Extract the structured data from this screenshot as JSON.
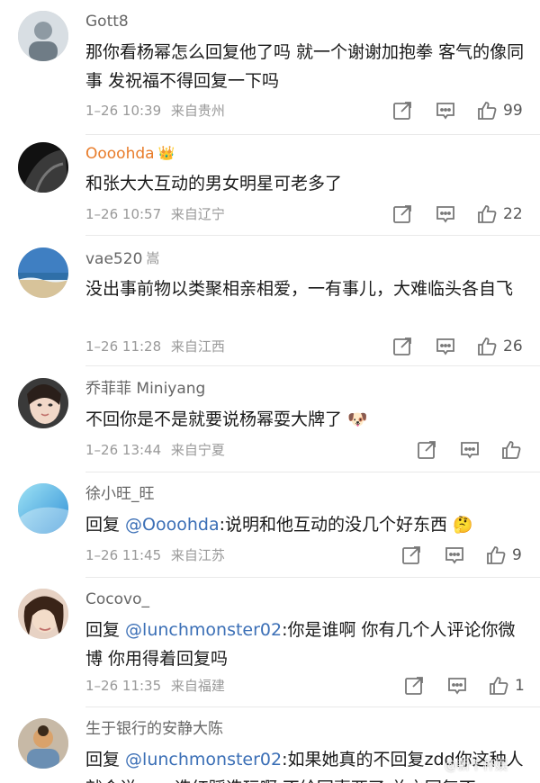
{
  "comments": [
    {
      "username": "Gott8",
      "text": "那你看杨幂怎么回复他了吗 就一个谢谢加抱拳 客气的像同事 发祝福不得回复一下吗",
      "time": "1–26 10:39",
      "location": "来自贵州",
      "likes": "99",
      "avatar_color": "#8e9aa3"
    },
    {
      "username": "Oooohda",
      "badge": "👑",
      "text": "和张大大互动的男女明星可老多了",
      "time": "1–26 10:57",
      "location": "来自辽宁",
      "likes": "22",
      "username_color": "#e87c2a",
      "avatar_color": "#2b2b2b"
    },
    {
      "username": "vae520",
      "badge": "嵩",
      "text": "没出事前物以类聚相亲相爱，一有事儿，大难临头各自飞",
      "time": "1–26 11:28",
      "location": "来自江西",
      "likes": "26",
      "avatar_color": "#3f7fc2"
    },
    {
      "username": "乔菲菲 Miniyang",
      "text": "不回你是不是就要说杨幂耍大牌了",
      "emoji": "🐶",
      "time": "1–26 13:44",
      "location": "来自宁夏",
      "likes": "",
      "avatar_color": "#caa58c"
    },
    {
      "username": "徐小旺_旺",
      "reply_prefix": "回复 ",
      "mention": "@Oooohda",
      "text": ":说明和他互动的没几个好东西",
      "emoji": "🤔",
      "time": "1–26 11:45",
      "location": "来自江苏",
      "likes": "9",
      "avatar_color": "#5bb6e8"
    },
    {
      "username": "Cocovo_",
      "reply_prefix": "回复 ",
      "mention": "@lunchmonster02",
      "text": ":你是谁啊 你有几个人评论你微博 你用得着回复吗",
      "time": "1–26 11:35",
      "location": "来自福建",
      "likes": "1",
      "avatar_color": "#b58a72"
    },
    {
      "username": "生于银行的安静大陈",
      "reply_prefix": "回复 ",
      "mention": "@lunchmonster02",
      "text": ":如果她真的不回复zdd你这种人就会说 ym 造红踩造玩啊 不给回事两了 总之回复不",
      "avatar_color": "#d9a26b"
    }
  ],
  "watermark": "@新千杯娱",
  "icons": [
    "share-icon",
    "comment-icon",
    "like-icon"
  ]
}
